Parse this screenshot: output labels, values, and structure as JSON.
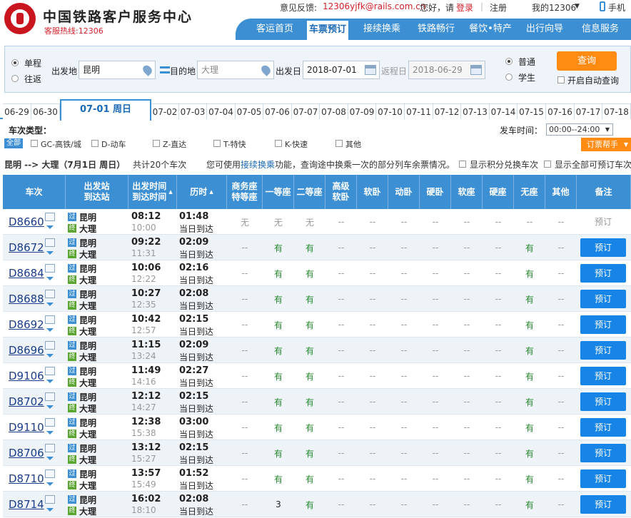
{
  "header": {
    "title": "中国铁路客户服务中心",
    "hotline": "客服热线:12306",
    "feedback_label": "意见反馈:",
    "feedback_email": "12306yjfk@rails.com.cn",
    "greeting": "您好，请",
    "login": "登录",
    "register": "注册",
    "my12306": "我的12306",
    "mobile": "手机",
    "nav": [
      "客运首页",
      "车票预订",
      "接续换乘",
      "铁路畅行",
      "餐饮•特产",
      "出行向导",
      "信息服务"
    ],
    "active_nav": "车票预订"
  },
  "search": {
    "trip_single": "单程",
    "trip_return": "往返",
    "from_label": "出发地",
    "from_value": "昆明",
    "to_label": "目的地",
    "to_placeholder": "大理",
    "date_label": "出发日",
    "date_value": "2018-07-01",
    "return_label": "返程日",
    "return_value": "2018-06-29",
    "type_normal": "普通",
    "type_student": "学生",
    "query_button": "查询",
    "auto_query": "开启自动查询"
  },
  "date_tabs": [
    "06-29",
    "06-30",
    "07-01 周日",
    "07-02",
    "07-03",
    "07-04",
    "07-05",
    "07-06",
    "07-07",
    "07-08",
    "07-09",
    "07-10",
    "07-11",
    "07-12",
    "07-13",
    "07-14",
    "07-15",
    "07-16",
    "07-17",
    "07-18"
  ],
  "filters": {
    "type_label": "车次类型：",
    "all": "全部",
    "types": [
      "GC-高铁/城",
      "D-动车",
      "Z-直达",
      "T-特快",
      "K-快速",
      "其他"
    ],
    "time_label": "发车时间：",
    "time_value": "00:00--24:00",
    "helper": "订票帮手"
  },
  "summary": {
    "route": "昆明 --> 大理（7月1日  周日）",
    "count": "共计20个车次",
    "tip_pre": "您可使用",
    "tip_link": "接续换乘",
    "tip_post": "功能，查询途中换乘一次的部分列车余票情况。",
    "points_label": "显示积分兑换车次",
    "all_label": "显示全部可预订车次"
  },
  "table": {
    "headers": [
      "车次",
      "出发站\n到达站",
      "出发时间\n到达时间",
      "历时",
      "商务座\n特等座",
      "一等座",
      "二等座",
      "高级\n软卧",
      "软卧",
      "动卧",
      "硬卧",
      "软座",
      "硬座",
      "无座",
      "其他",
      "备注"
    ],
    "pass_badge": "过",
    "end_badge": "终",
    "same_day": "当日到达",
    "book_label": "预订",
    "rows": [
      {
        "no": "D8660",
        "from": "昆明",
        "to": "大理",
        "dep": "08:12",
        "arr": "10:00",
        "dur": "01:48",
        "seats": [
          "无",
          "无",
          "无",
          "--",
          "--",
          "--",
          "--",
          "--",
          "--",
          "--",
          "--"
        ],
        "bookable": false
      },
      {
        "no": "D8672",
        "from": "昆明",
        "to": "大理",
        "dep": "09:22",
        "arr": "11:31",
        "dur": "02:09",
        "seats": [
          "--",
          "有",
          "有",
          "--",
          "--",
          "--",
          "--",
          "--",
          "--",
          "有",
          "--"
        ],
        "bookable": true
      },
      {
        "no": "D8684",
        "from": "昆明",
        "to": "大理",
        "dep": "10:06",
        "arr": "12:22",
        "dur": "02:16",
        "seats": [
          "--",
          "有",
          "有",
          "--",
          "--",
          "--",
          "--",
          "--",
          "--",
          "有",
          "--"
        ],
        "bookable": true
      },
      {
        "no": "D8688",
        "from": "昆明",
        "to": "大理",
        "dep": "10:27",
        "arr": "12:35",
        "dur": "02:08",
        "seats": [
          "--",
          "有",
          "有",
          "--",
          "--",
          "--",
          "--",
          "--",
          "--",
          "有",
          "--"
        ],
        "bookable": true
      },
      {
        "no": "D8692",
        "from": "昆明",
        "to": "大理",
        "dep": "10:42",
        "arr": "12:57",
        "dur": "02:15",
        "seats": [
          "--",
          "有",
          "有",
          "--",
          "--",
          "--",
          "--",
          "--",
          "--",
          "有",
          "--"
        ],
        "bookable": true
      },
      {
        "no": "D8696",
        "from": "昆明",
        "to": "大理",
        "dep": "11:15",
        "arr": "13:24",
        "dur": "02:09",
        "seats": [
          "--",
          "有",
          "有",
          "--",
          "--",
          "--",
          "--",
          "--",
          "--",
          "有",
          "--"
        ],
        "bookable": true
      },
      {
        "no": "D9106",
        "from": "昆明",
        "to": "大理",
        "dep": "11:49",
        "arr": "14:16",
        "dur": "02:27",
        "seats": [
          "--",
          "有",
          "有",
          "--",
          "--",
          "--",
          "--",
          "--",
          "--",
          "有",
          "--"
        ],
        "bookable": true
      },
      {
        "no": "D8702",
        "from": "昆明",
        "to": "大理",
        "dep": "12:12",
        "arr": "14:27",
        "dur": "02:15",
        "seats": [
          "--",
          "有",
          "有",
          "--",
          "--",
          "--",
          "--",
          "--",
          "--",
          "有",
          "--"
        ],
        "bookable": true
      },
      {
        "no": "D9110",
        "from": "昆明",
        "to": "大理",
        "dep": "12:38",
        "arr": "15:38",
        "dur": "03:00",
        "seats": [
          "--",
          "有",
          "有",
          "--",
          "--",
          "--",
          "--",
          "--",
          "--",
          "有",
          "--"
        ],
        "bookable": true
      },
      {
        "no": "D8706",
        "from": "昆明",
        "to": "大理",
        "dep": "13:12",
        "arr": "15:27",
        "dur": "02:15",
        "seats": [
          "--",
          "有",
          "有",
          "--",
          "--",
          "--",
          "--",
          "--",
          "--",
          "有",
          "--"
        ],
        "bookable": true
      },
      {
        "no": "D8710",
        "from": "昆明",
        "to": "大理",
        "dep": "13:57",
        "arr": "15:49",
        "dur": "01:52",
        "seats": [
          "--",
          "有",
          "有",
          "--",
          "--",
          "--",
          "--",
          "--",
          "--",
          "有",
          "--"
        ],
        "bookable": true
      },
      {
        "no": "D8714",
        "from": "昆明",
        "to": "大理",
        "dep": "16:02",
        "arr": "18:10",
        "dur": "02:08",
        "seats": [
          "--",
          "3",
          "有",
          "--",
          "--",
          "--",
          "--",
          "--",
          "--",
          "有",
          "--"
        ],
        "bookable": true
      }
    ]
  }
}
